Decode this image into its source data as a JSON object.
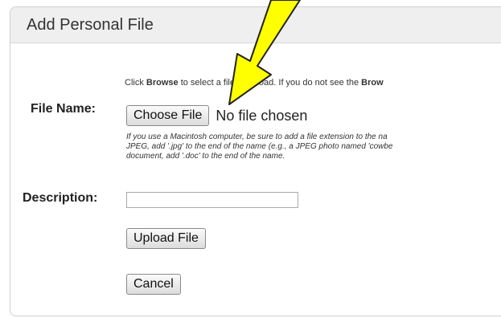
{
  "panel": {
    "title": "Add Personal File"
  },
  "instructions": {
    "part1": "Click ",
    "browse_bold": "Browse",
    "part2": " to select a file to upload. If you do not see the ",
    "browse_bold_2": "Brow"
  },
  "file": {
    "label": "File Name:",
    "choose_button": "Choose File",
    "status": "No file chosen",
    "hint_line1": "If you use a Macintosh computer, be sure to add a file extension to the na",
    "hint_line2": "JPEG, add '.jpg' to the end of the name (e.g., a JPEG photo named 'cowbe",
    "hint_line3": "document, add '.doc' to the end of the name."
  },
  "description": {
    "label": "Description:",
    "value": ""
  },
  "buttons": {
    "upload": "Upload File",
    "cancel": "Cancel"
  },
  "colors": {
    "arrow_fill": "#ffff00",
    "arrow_stroke": "#222222"
  }
}
